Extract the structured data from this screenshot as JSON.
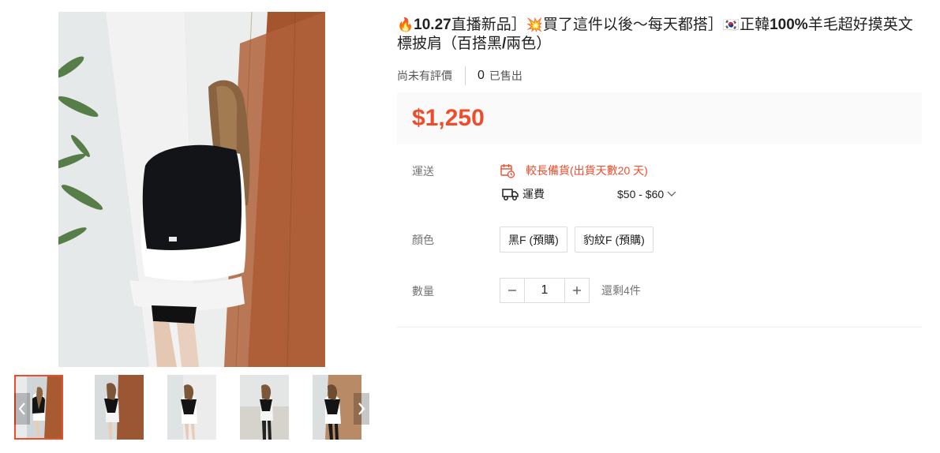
{
  "product": {
    "title_parts": [
      {
        "type": "emoji",
        "icon": "fire-icon",
        "text": "🔥"
      },
      {
        "type": "bold",
        "text": "10.27"
      },
      {
        "type": "text",
        "text": "直播新品］"
      },
      {
        "type": "emoji",
        "icon": "collision-icon",
        "text": "💥"
      },
      {
        "type": "text",
        "text": "買了這件以後～每天都搭］"
      },
      {
        "type": "emoji",
        "icon": "korea-flag-icon",
        "text": "🇰🇷"
      },
      {
        "type": "text",
        "text": "正韓"
      },
      {
        "type": "bold",
        "text": "100%"
      },
      {
        "type": "text",
        "text": "羊毛超好摸英文標披肩（百搭黑"
      },
      {
        "type": "bold",
        "text": "/"
      },
      {
        "type": "text",
        "text": "兩色）"
      }
    ],
    "rating_text": "尚未有評價",
    "sold_count": "0",
    "sold_label": "已售出",
    "price": "$1,250",
    "accent_color": "#ee4d2d"
  },
  "shipping": {
    "label": "運送",
    "warning_icon": "calendar-clock-icon",
    "warning_text": "較長備貨(出貨天數20 天)",
    "fee_icon": "truck-icon",
    "fee_label": "運費",
    "fee_range": "$50 - $60"
  },
  "color": {
    "label": "顏色",
    "options": [
      "黑F (預購)",
      "豹紋F (預購)"
    ]
  },
  "quantity": {
    "label": "數量",
    "value": "1",
    "stock_text": "還剩4件"
  },
  "gallery": {
    "thumbnail_count": 5,
    "active_thumbnail": 0
  }
}
